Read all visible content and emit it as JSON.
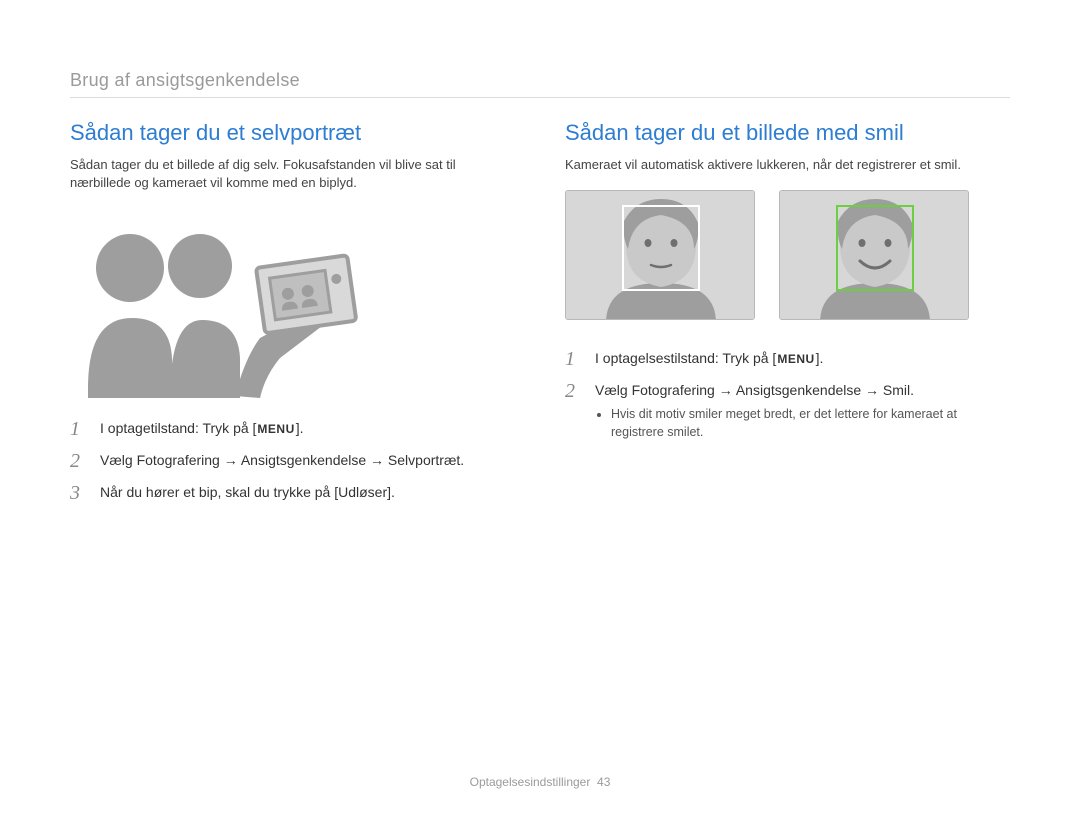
{
  "breadcrumb": "Brug af ansigtsgenkendelse",
  "left": {
    "title": "Sådan tager du et selvportræt",
    "intro": "Sådan tager du et billede af dig selv. Fokusafstanden vil blive sat til nærbillede og kameraet vil komme med en biplyd.",
    "steps": [
      {
        "num": "1",
        "before": "I optagetilstand: Tryk på [",
        "chip": "MENU",
        "after": "]."
      },
      {
        "num": "2",
        "text": "Vælg Fotografering → Ansigtsgenkendelse → Selvportræt."
      },
      {
        "num": "3",
        "text": "Når du hører et bip, skal du trykke på [Udløser]."
      }
    ]
  },
  "right": {
    "title": "Sådan tager du et billede med smil",
    "intro": "Kameraet vil automatisk aktivere lukkeren, når det registrerer et smil.",
    "steps": [
      {
        "num": "1",
        "before": "I optagelsestilstand: Tryk på [",
        "chip": "MENU",
        "after": "]."
      },
      {
        "num": "2",
        "text": "Vælg Fotografering → Ansigtsgenkendelse → Smil.",
        "bullets": [
          "Hvis dit motiv smiler meget bredt, er det lettere for kameraet at registrere smilet."
        ]
      }
    ]
  },
  "footer": {
    "section": "Optagelsesindstillinger",
    "page": "43"
  }
}
